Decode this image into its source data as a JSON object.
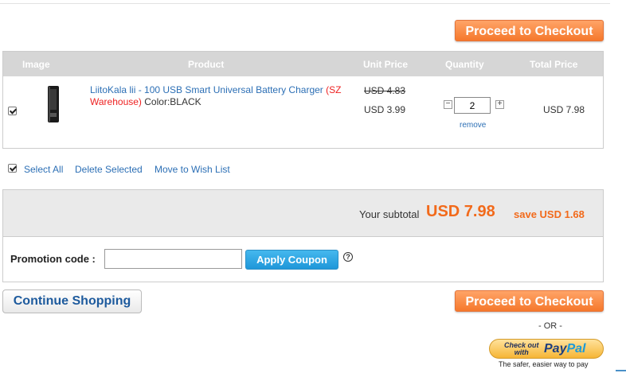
{
  "checkout_label": "Proceed to Checkout",
  "table": {
    "headers": [
      "Image",
      "Product",
      "Unit Price",
      "Quantity",
      "Total Price"
    ]
  },
  "item": {
    "name": "LiitoKala lii - 100 USB Smart Universal Battery Charger",
    "warehouse": "(SZ Warehouse)",
    "color_label": "Color:",
    "color_value": "BLACK",
    "old_price": "USD 4.83",
    "price": "USD 3.99",
    "quantity": "2",
    "remove": "remove",
    "total": "USD 7.98",
    "minus": "−",
    "plus": "+"
  },
  "actions": {
    "select_all": "Select All",
    "delete_selected": "Delete Selected",
    "move_to_wishlist": "Move to Wish List"
  },
  "summary": {
    "subtotal_label": "Your subtotal",
    "subtotal_value": "USD 7.98",
    "save_text": "save USD 1.68"
  },
  "promo": {
    "label": "Promotion code :",
    "input_value": "",
    "apply_label": "Apply Coupon",
    "help": "?"
  },
  "continue_label": "Continue Shopping",
  "or_text": "- OR -",
  "paypal": {
    "small_text_1": "Check out",
    "small_text_2": "with",
    "brand_1": "Pay",
    "brand_2": "Pal",
    "tagline": "The safer, easier way to pay"
  },
  "colors": {
    "orange_button": "#f5782c",
    "blue_button": "#1f97d9",
    "subtotal_orange": "#f26a1b",
    "link_blue": "#2c6fb5"
  }
}
